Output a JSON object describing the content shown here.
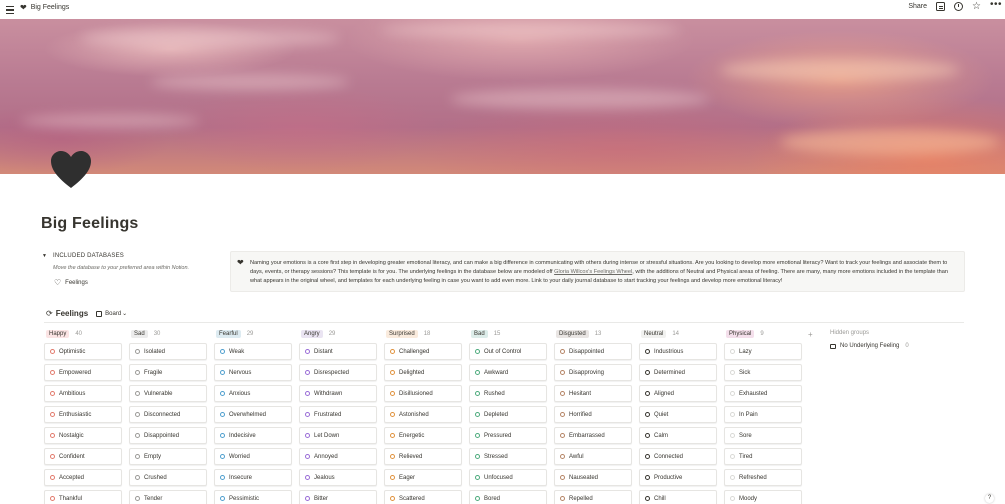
{
  "breadcrumb": {
    "title": "Big Feelings"
  },
  "top_actions": {
    "share": "Share"
  },
  "page": {
    "title": "Big Feelings"
  },
  "toggle": {
    "label": "INCLUDED DATABASES",
    "note": "Move the database to your preferred area within Notion.",
    "linked_db": "Feelings"
  },
  "callout": {
    "text_before_link": "Naming your emotions is a core first step in developing greater emotional literacy, and can make a big difference in communicating with others during intense or stressful situations.  Are you looking to develop more emotional literacy? Want to track your feelings and associate them to days, events, or therapy sessions? This template is for you. The underlying feelings in the database below are modeled off ",
    "link": "Gloria Willcox's Feelings Wheel",
    "text_after_link": ", with the additions of Neutral and Physical areas of feeling. There are many, many more emotions included in the template than what appears in the original wheel, and templates for each underlying feeling in case you want to add even more. Link to your daily journal database to start tracking your feelings and develop more emotional literacy!"
  },
  "database": {
    "name": "Feelings",
    "view": "Board"
  },
  "board": {
    "columns": [
      {
        "label": "Happy",
        "count": "40",
        "tag_bg": "#fbe4e4",
        "dot": "#e27a6c",
        "cards": [
          "Optimistic",
          "Empowered",
          "Ambitious",
          "Enthusiastic",
          "Nostalgic",
          "Confident",
          "Accepted",
          "Thankful",
          "Invigorated"
        ]
      },
      {
        "label": "Sad",
        "count": "30",
        "tag_bg": "#ececec",
        "dot": "#9b9a97",
        "cards": [
          "Isolated",
          "Fragile",
          "Vulnerable",
          "Disconnected",
          "Disappointed",
          "Empty",
          "Crushed",
          "Tender",
          "Forgotten"
        ]
      },
      {
        "label": "Fearful",
        "count": "29",
        "tag_bg": "#ddebf1",
        "dot": "#4f9fce",
        "cards": [
          "Weak",
          "Nervous",
          "Anxious",
          "Overwhelmed",
          "Indecisive",
          "Worried",
          "Insecure",
          "Pessimistic",
          "Exposed"
        ]
      },
      {
        "label": "Angry",
        "count": "29",
        "tag_bg": "#eae4f2",
        "dot": "#9a6dd7",
        "cards": [
          "Distant",
          "Disrespected",
          "Withdrawn",
          "Frustrated",
          "Let Down",
          "Annoyed",
          "Jealous",
          "Bitter",
          "Fed Up"
        ]
      },
      {
        "label": "Surprised",
        "count": "18",
        "tag_bg": "#faebdd",
        "dot": "#e0923d",
        "cards": [
          "Challenged",
          "Delighted",
          "Disillusioned",
          "Astonished",
          "Energetic",
          "Relieved",
          "Eager",
          "Scattered",
          "Excited"
        ]
      },
      {
        "label": "Bad",
        "count": "15",
        "tag_bg": "#ddedea",
        "dot": "#4dab7d",
        "cards": [
          "Out of Control",
          "Awkward",
          "Rushed",
          "Depleted",
          "Pressured",
          "Stressed",
          "Unfocused",
          "Bored",
          "Sleepy"
        ]
      },
      {
        "label": "Disgusted",
        "count": "13",
        "tag_bg": "#e9e5e3",
        "dot": "#b58566",
        "cards": [
          "Disappointed",
          "Disapproving",
          "Hesitant",
          "Horrified",
          "Embarrassed",
          "Awful",
          "Nauseated",
          "Repelled",
          "Uncomfortable"
        ]
      },
      {
        "label": "Neutral",
        "count": "14",
        "tag_bg": "#f1f1ef",
        "dot": "#37352f",
        "cards": [
          "Industrious",
          "Determined",
          "Aligned",
          "Quiet",
          "Calm",
          "Connected",
          "Productive",
          "Chill",
          "Distracted"
        ]
      },
      {
        "label": "Physical",
        "count": "9",
        "tag_bg": "#f4dfeb",
        "dot": "#d9d9d6",
        "cards": [
          "Lazy",
          "Sick",
          "Exhausted",
          "In Pain",
          "Sore",
          "Tired",
          "Refreshed",
          "Moody",
          "Lethargic"
        ]
      }
    ]
  },
  "hidden_groups": {
    "title": "Hidden groups",
    "item": "No Underlying Feeling",
    "count": "0"
  },
  "help": "?"
}
